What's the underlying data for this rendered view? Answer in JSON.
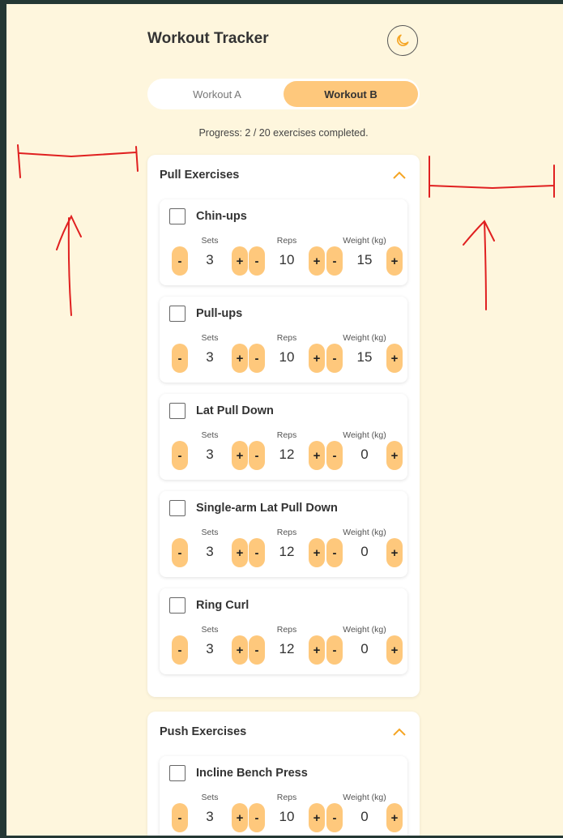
{
  "app": {
    "title": "Workout Tracker",
    "theme_toggle_icon": "moon-icon"
  },
  "tabs": [
    {
      "label": "Workout A",
      "active": false
    },
    {
      "label": "Workout B",
      "active": true
    }
  ],
  "progress_text": "Progress: 2 / 20 exercises completed.",
  "colors": {
    "accent": "#fec87c",
    "background": "#fef6dd",
    "chevron": "#f5a524",
    "annotation": "#e02020"
  },
  "field_labels": {
    "sets": "Sets",
    "reps": "Reps",
    "weight": "Weight (kg)"
  },
  "buttons": {
    "minus": "-",
    "plus": "+"
  },
  "sections": [
    {
      "title": "Pull Exercises",
      "expanded": true,
      "exercises": [
        {
          "name": "Chin-ups",
          "checked": false,
          "sets": "3",
          "reps": "10",
          "weight": "15"
        },
        {
          "name": "Pull-ups",
          "checked": false,
          "sets": "3",
          "reps": "10",
          "weight": "15"
        },
        {
          "name": "Lat Pull Down",
          "checked": false,
          "sets": "3",
          "reps": "12",
          "weight": "0"
        },
        {
          "name": "Single-arm Lat Pull Down",
          "checked": false,
          "sets": "3",
          "reps": "12",
          "weight": "0"
        },
        {
          "name": "Ring Curl",
          "checked": false,
          "sets": "3",
          "reps": "12",
          "weight": "0"
        }
      ]
    },
    {
      "title": "Push Exercises",
      "expanded": true,
      "exercises": [
        {
          "name": "Incline Bench Press",
          "checked": false,
          "sets": "3",
          "reps": "10",
          "weight": "0"
        }
      ]
    }
  ]
}
